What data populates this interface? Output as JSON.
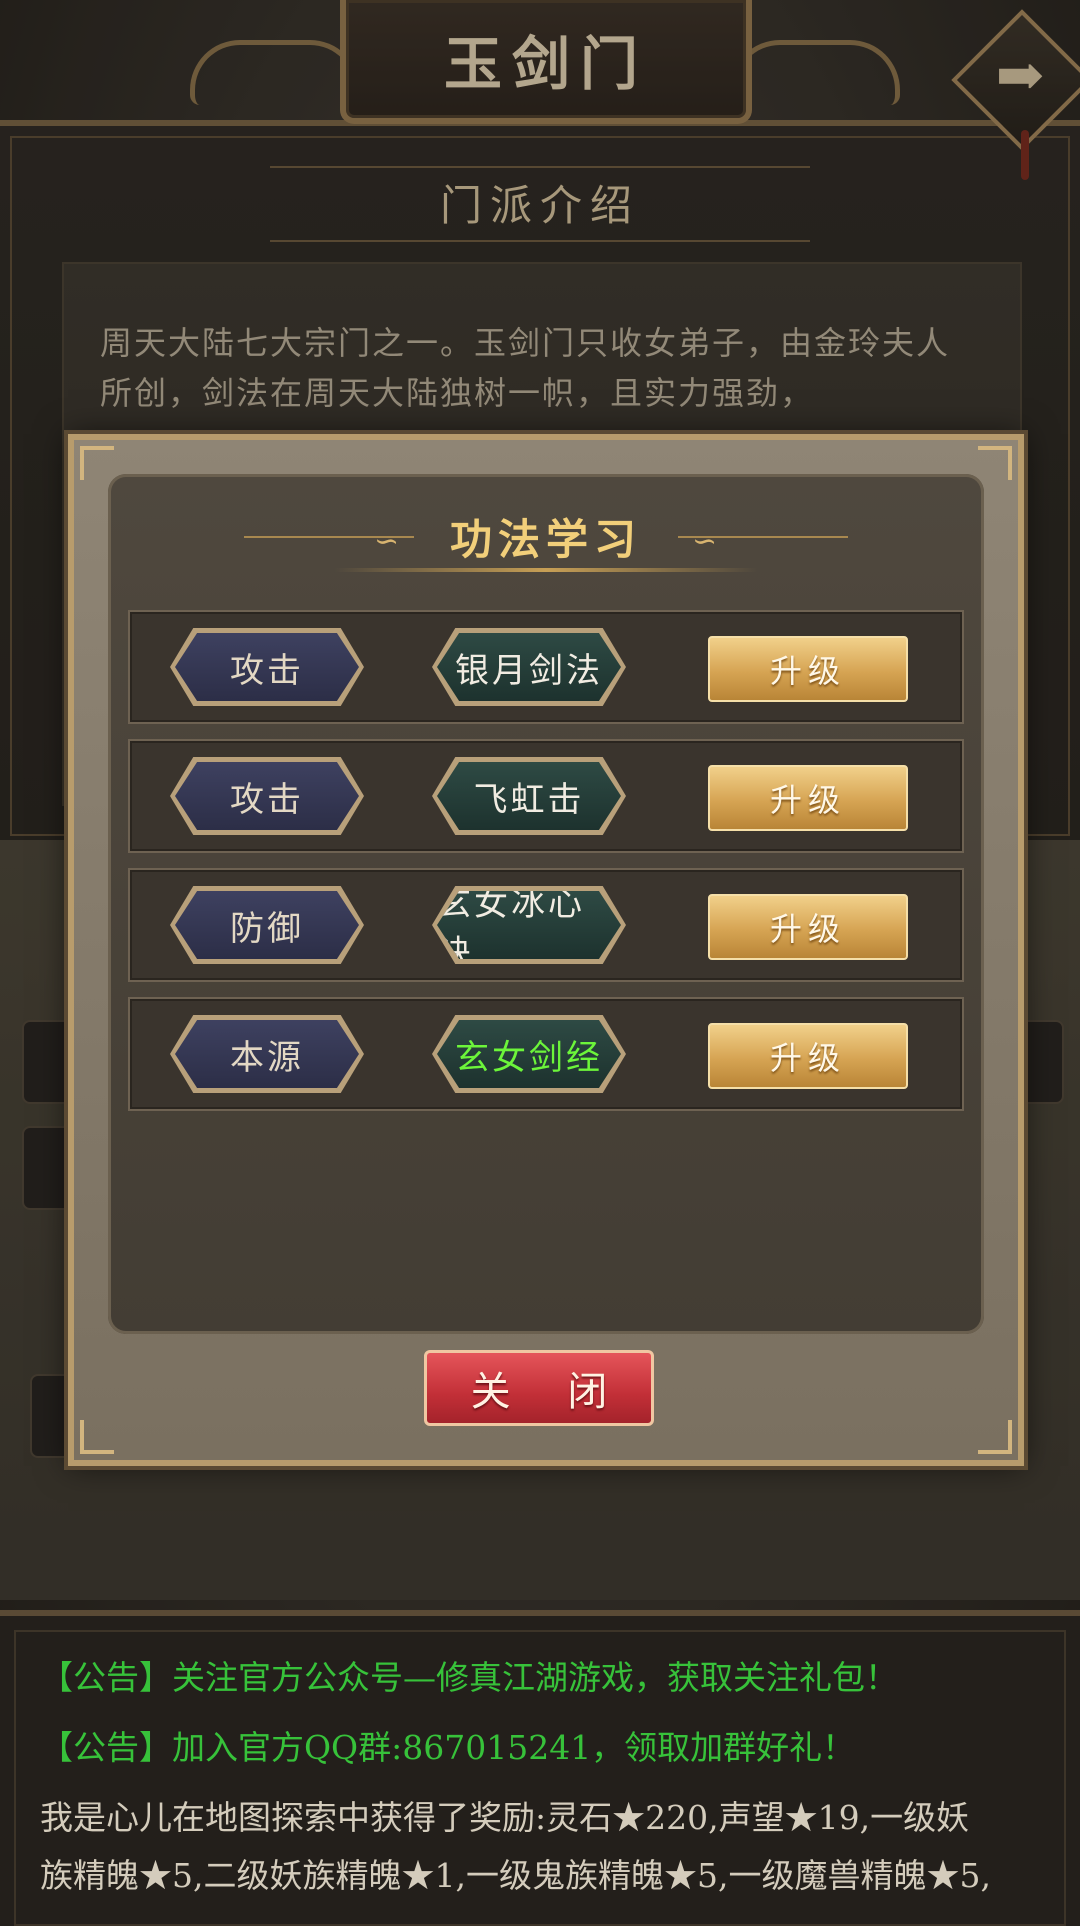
{
  "header": {
    "title": "玉剑门",
    "nav_arrow_icon": "arrow-right-icon"
  },
  "sect_intro": {
    "heading": "门派介绍",
    "text": "周天大陆七大宗门之一。玉剑门只收女弟子，由金玲夫人所创，剑法在周天大陆独树一帜，且实力强劲，"
  },
  "modal": {
    "title": "功法学习",
    "rows": [
      {
        "type": "攻击",
        "skill": "银月剑法",
        "action": "升级"
      },
      {
        "type": "攻击",
        "skill": "飞虹击",
        "action": "升级"
      },
      {
        "type": "防御",
        "skill": "玄女冰心诀",
        "action": "升级"
      },
      {
        "type": "本源",
        "skill": "玄女剑经",
        "action": "升级",
        "highlight": true
      }
    ],
    "close_label": "关 闭"
  },
  "announcements": [
    {
      "text": "【公告】关注官方公众号—修真江湖游戏，获取关注礼包！",
      "color": "#37c23a"
    },
    {
      "text": "【公告】加入官方QQ群:867015241，领取加群好礼！",
      "color": "#37c23a"
    },
    {
      "text": "我是心儿在地图探索中获得了奖励:灵石★220,声望★19,一级妖",
      "color": "#d4ccbc"
    },
    {
      "text": "族精魄★5,二级妖族精魄★1,一级鬼族精魄★5,一级魔兽精魄★5,",
      "color": "#d4ccbc"
    }
  ],
  "colors": {
    "upgrade_button": "#d6a453",
    "close_button": "#c22f37",
    "highlight_skill": "#6cf53a",
    "announcement_green": "#37c23a"
  }
}
